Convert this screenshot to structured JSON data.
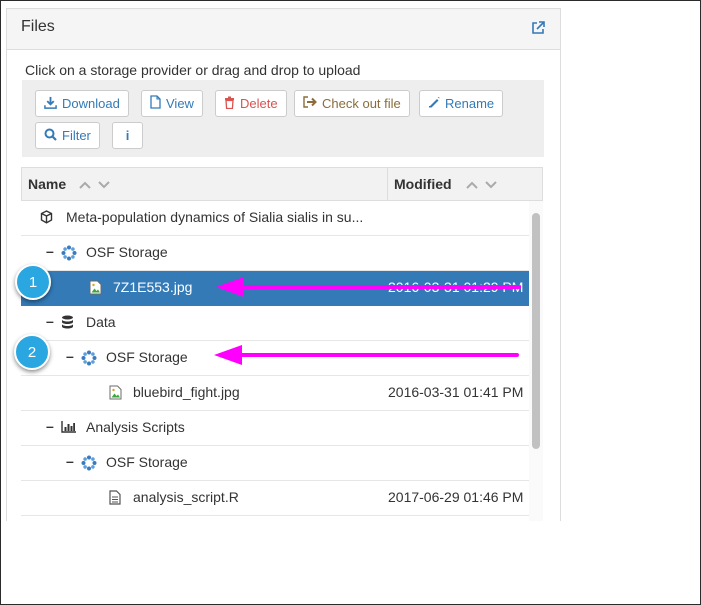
{
  "panel": {
    "title": "Files",
    "expand_icon": "external-link-icon",
    "instructions": "Click on a storage provider or drag and drop to upload"
  },
  "toolbar": {
    "download": "Download",
    "view": "View",
    "delete": "Delete",
    "checkout": "Check out file",
    "rename": "Rename",
    "filter": "Filter",
    "info": "i"
  },
  "grid": {
    "col_name": "Name",
    "col_modified": "Modified",
    "rows": [
      {
        "name": "Meta-population dynamics of Sialia sialis in su...",
        "modified": "",
        "icon": "cube-icon"
      },
      {
        "name": "OSF Storage",
        "modified": "",
        "icon": "osf-storage-icon"
      },
      {
        "name": "7Z1E553.jpg",
        "modified": "2016-03-31 01:29 PM",
        "icon": "image-file-icon"
      },
      {
        "name": "Data",
        "modified": "",
        "icon": "database-icon"
      },
      {
        "name": "OSF Storage",
        "modified": "",
        "icon": "osf-storage-icon"
      },
      {
        "name": "bluebird_fight.jpg",
        "modified": "2016-03-31 01:41 PM",
        "icon": "image-file-icon"
      },
      {
        "name": "Analysis Scripts",
        "modified": "",
        "icon": "bar-chart-icon"
      },
      {
        "name": "OSF Storage",
        "modified": "",
        "icon": "osf-storage-icon"
      },
      {
        "name": "analysis_script.R",
        "modified": "2017-06-29 01:46 PM",
        "icon": "text-file-icon"
      }
    ]
  },
  "annotations": {
    "badge1": "1",
    "badge2": "2",
    "arrow_color": "#ff00ff",
    "badge_color": "#2aa6e0"
  },
  "colors": {
    "selected_row": "#337ab7",
    "link_blue": "#337ab7",
    "delete_red": "#d9534f",
    "checkout_brown": "#8a6d3b"
  }
}
